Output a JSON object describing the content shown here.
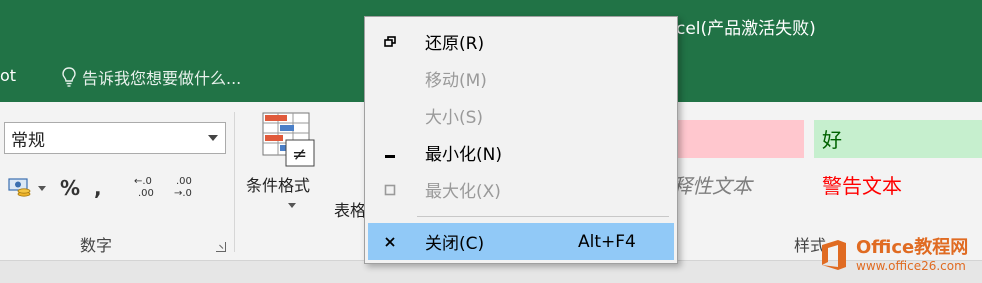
{
  "window": {
    "title_partial": "cel(产品激活失败)"
  },
  "tabs": {
    "partial_tab": "ot",
    "tell_me": "告诉我您想要做什么..."
  },
  "number_group": {
    "format_value": "常规",
    "percent": "%",
    "comma": ",",
    "increase_decimal": "←.0 .00",
    "decrease_decimal": ".00 →.0",
    "label": "数字"
  },
  "conditional_format": {
    "label": "条件格式"
  },
  "table_format": {
    "label_partial": "表格"
  },
  "styles": {
    "bad": "",
    "good": "好",
    "explanatory_partial": "释性文本",
    "warning": "警告文本",
    "label_partial": "样式"
  },
  "system_menu": {
    "items": [
      {
        "label": "还原(R)",
        "accelerator": "",
        "enabled": true,
        "icon": "restore-icon"
      },
      {
        "label": "移动(M)",
        "accelerator": "",
        "enabled": false,
        "icon": ""
      },
      {
        "label": "大小(S)",
        "accelerator": "",
        "enabled": false,
        "icon": ""
      },
      {
        "label": "最小化(N)",
        "accelerator": "",
        "enabled": true,
        "icon": "minimize-icon"
      },
      {
        "label": "最大化(X)",
        "accelerator": "",
        "enabled": false,
        "icon": "maximize-icon"
      },
      {
        "label": "关闭(C)",
        "accelerator": "Alt+F4",
        "enabled": true,
        "icon": "close-icon",
        "highlighted": true
      }
    ]
  },
  "watermark": {
    "name": "Office教程网",
    "url": "www.office26.com"
  },
  "colors": {
    "title_bar": "#217346",
    "menu_highlight": "#91c9f7",
    "bad_style_fill": "#ffc7ce",
    "good_style_fill": "#c6efce",
    "warning_text": "#ff0000",
    "brand_orange": "#e06b22"
  }
}
